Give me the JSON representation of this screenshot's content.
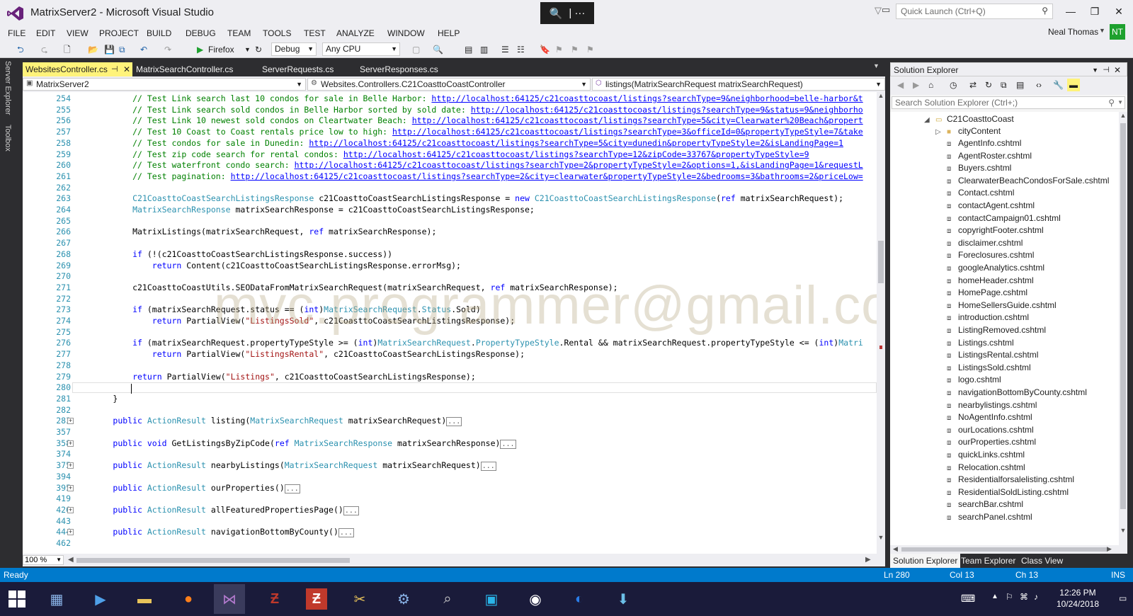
{
  "window": {
    "title": "MatrixServer2 - Microsoft Visual Studio",
    "quick_launch_placeholder": "Quick Launch (Ctrl+Q)",
    "user": "Neal Thomas",
    "avatar_initials": "NT",
    "zoom_tool_label": "| ···"
  },
  "menu": [
    "FILE",
    "EDIT",
    "VIEW",
    "PROJECT",
    "BUILD",
    "DEBUG",
    "TEAM",
    "TOOLS",
    "TEST",
    "ANALYZE",
    "WINDOW",
    "HELP"
  ],
  "toolbar": {
    "run_target": "Firefox",
    "configuration": "Debug",
    "platform": "Any CPU"
  },
  "left_rail": [
    "Server Explorer",
    "Toolbox"
  ],
  "doc_tabs": [
    {
      "label": "WebsitesController.cs",
      "active": true
    },
    {
      "label": "MatrixSearchController.cs",
      "active": false
    },
    {
      "label": "ServerRequests.cs",
      "active": false
    },
    {
      "label": "ServerResponses.cs",
      "active": false
    }
  ],
  "nav": {
    "project": "MatrixServer2",
    "class": "Websites.Controllers.C21CoasttoCoastController",
    "member": "listings(MatrixSearchRequest matrixSearchRequest)"
  },
  "code_lines": [
    {
      "n": "254",
      "segs": [
        [
          "cm",
          "            // Test Link search last 10 condos for sale in Belle Harbor: "
        ],
        [
          "lk",
          "http://localhost:64125/c21coasttocoast/listings?searchType=9&neighborhood=belle-harbor&t"
        ]
      ]
    },
    {
      "n": "255",
      "segs": [
        [
          "cm",
          "            // Test Link search sold condos in Belle Harbor sorted by sold date: "
        ],
        [
          "lk",
          "http://localhost:64125/c21coasttocoast/listings?searchType=9&status=9&neighborho"
        ]
      ]
    },
    {
      "n": "256",
      "segs": [
        [
          "cm",
          "            // Test Link 10 newest sold condos on Cleartwater Beach: "
        ],
        [
          "lk",
          "http://localhost:64125/c21coasttocoast/listings?searchType=5&city=Clearwater%20Beach&propert"
        ]
      ]
    },
    {
      "n": "257",
      "segs": [
        [
          "cm",
          "            // Test 10 Coast to Coast rentals price low to high: "
        ],
        [
          "lk",
          "http://localhost:64125/c21coasttocoast/listings?searchType=3&officeId=0&propertyTypeStyle=7&take"
        ]
      ]
    },
    {
      "n": "258",
      "segs": [
        [
          "cm",
          "            // Test condos for sale in Dunedin: "
        ],
        [
          "lk",
          "http://localhost:64125/c21coasttocoast/listings?searchType=5&city=dunedin&propertyTypeStyle=2&isLandingPage=1"
        ]
      ]
    },
    {
      "n": "259",
      "segs": [
        [
          "cm",
          "            // Test zip code search for rental condos: "
        ],
        [
          "lk",
          "http://localhost:64125/c21coasttocoast/listings?searchType=12&zipCode=33767&propertyTypeStyle=9"
        ]
      ]
    },
    {
      "n": "260",
      "segs": [
        [
          "cm",
          "            // Test waterfront condo search: "
        ],
        [
          "lk",
          "http://localhost:64125/c21coasttocoast/listings?searchType=2&propertyTypeStyle=2&options=1,&isLandingPage=1&requestL"
        ]
      ]
    },
    {
      "n": "261",
      "segs": [
        [
          "cm",
          "            // Test pagination: "
        ],
        [
          "lk",
          "http://localhost:64125/c21coasttocoast/listings?searchType=2&city=clearwater&propertyTypeStyle=2&bedrooms=3&bathrooms=2&priceLow="
        ]
      ]
    },
    {
      "n": "262",
      "segs": []
    },
    {
      "n": "263",
      "segs": [
        [
          "",
          "            "
        ],
        [
          "ty",
          "C21CoasttoCoastSearchListingsResponse"
        ],
        [
          "",
          " c21CoasttoCoastSearchListingsResponse = "
        ],
        [
          "kw",
          "new"
        ],
        [
          "",
          " "
        ],
        [
          "ty",
          "C21CoasttoCoastSearchListingsResponse"
        ],
        [
          "",
          "("
        ],
        [
          "kw",
          "ref"
        ],
        [
          "",
          " matrixSearchRequest);"
        ]
      ]
    },
    {
      "n": "264",
      "segs": [
        [
          "",
          "            "
        ],
        [
          "ty",
          "MatrixSearchResponse"
        ],
        [
          "",
          " matrixSearchResponse = c21CoasttoCoastSearchListingsResponse;"
        ]
      ]
    },
    {
      "n": "265",
      "segs": []
    },
    {
      "n": "266",
      "segs": [
        [
          "",
          "            MatrixListings(matrixSearchRequest, "
        ],
        [
          "kw",
          "ref"
        ],
        [
          "",
          " matrixSearchResponse);"
        ]
      ]
    },
    {
      "n": "267",
      "segs": []
    },
    {
      "n": "268",
      "segs": [
        [
          "",
          "            "
        ],
        [
          "kw",
          "if"
        ],
        [
          "",
          " (!(c21CoasttoCoastSearchListingsResponse.success))"
        ]
      ]
    },
    {
      "n": "269",
      "segs": [
        [
          "",
          "                "
        ],
        [
          "kw",
          "return"
        ],
        [
          "",
          " Content(c21CoasttoCoastSearchListingsResponse.errorMsg);"
        ]
      ]
    },
    {
      "n": "270",
      "segs": []
    },
    {
      "n": "271",
      "segs": [
        [
          "",
          "            c21CoasttoCoastUtils.SEODataFromMatrixSearchRequest(matrixSearchRequest, "
        ],
        [
          "kw",
          "ref"
        ],
        [
          "",
          " matrixSearchResponse);"
        ]
      ]
    },
    {
      "n": "272",
      "segs": []
    },
    {
      "n": "273",
      "segs": [
        [
          "",
          "            "
        ],
        [
          "kw",
          "if"
        ],
        [
          "",
          " (matrixSearchRequest.status == ("
        ],
        [
          "kw",
          "int"
        ],
        [
          "",
          ")"
        ],
        [
          "ty",
          "MatrixSearchRequest"
        ],
        [
          "",
          "."
        ],
        [
          "ty",
          "Status"
        ],
        [
          "",
          ".Sold)"
        ]
      ]
    },
    {
      "n": "274",
      "segs": [
        [
          "",
          "                "
        ],
        [
          "kw",
          "return"
        ],
        [
          "",
          " PartialView("
        ],
        [
          "st",
          "\"ListingsSold\""
        ],
        [
          "",
          ", c21CoasttoCoastSearchListingsResponse);"
        ]
      ]
    },
    {
      "n": "275",
      "segs": []
    },
    {
      "n": "276",
      "segs": [
        [
          "",
          "            "
        ],
        [
          "kw",
          "if"
        ],
        [
          "",
          " (matrixSearchRequest.propertyTypeStyle >= ("
        ],
        [
          "kw",
          "int"
        ],
        [
          "",
          ")"
        ],
        [
          "ty",
          "MatrixSearchRequest"
        ],
        [
          "",
          "."
        ],
        [
          "ty",
          "PropertyTypeStyle"
        ],
        [
          "",
          ".Rental && matrixSearchRequest.propertyTypeStyle <= ("
        ],
        [
          "kw",
          "int"
        ],
        [
          "",
          ")"
        ],
        [
          "ty",
          "Matri"
        ]
      ]
    },
    {
      "n": "277",
      "segs": [
        [
          "",
          "                "
        ],
        [
          "kw",
          "return"
        ],
        [
          "",
          " PartialView("
        ],
        [
          "st",
          "\"ListingsRental\""
        ],
        [
          "",
          ", c21CoasttoCoastSearchListingsResponse);"
        ]
      ]
    },
    {
      "n": "278",
      "segs": []
    },
    {
      "n": "279",
      "segs": [
        [
          "",
          "            "
        ],
        [
          "kw",
          "return"
        ],
        [
          "",
          " PartialView("
        ],
        [
          "st",
          "\"Listings\""
        ],
        [
          "",
          ", c21CoasttoCoastSearchListingsResponse);"
        ]
      ]
    },
    {
      "n": "280",
      "segs": [
        [
          "",
          "            "
        ]
      ]
    },
    {
      "n": "281",
      "segs": [
        [
          "",
          "        }"
        ]
      ]
    },
    {
      "n": "282",
      "segs": []
    },
    {
      "n": "283",
      "fold": true,
      "segs": [
        [
          "",
          "        "
        ],
        [
          "kw",
          "public"
        ],
        [
          "",
          " "
        ],
        [
          "ty",
          "ActionResult"
        ],
        [
          "",
          " listing("
        ],
        [
          "ty",
          "MatrixSearchRequest"
        ],
        [
          "",
          " matrixSearchRequest)"
        ],
        [
          "collapsed",
          "..."
        ]
      ]
    },
    {
      "n": "357",
      "segs": []
    },
    {
      "n": "358",
      "fold": true,
      "segs": [
        [
          "",
          "        "
        ],
        [
          "kw",
          "public"
        ],
        [
          "",
          " "
        ],
        [
          "kw",
          "void"
        ],
        [
          "",
          " GetListingsByZipCode("
        ],
        [
          "kw",
          "ref"
        ],
        [
          "",
          " "
        ],
        [
          "ty",
          "MatrixSearchResponse"
        ],
        [
          "",
          " matrixSearchResponse)"
        ],
        [
          "collapsed",
          "..."
        ]
      ]
    },
    {
      "n": "374",
      "segs": []
    },
    {
      "n": "375",
      "fold": true,
      "segs": [
        [
          "",
          "        "
        ],
        [
          "kw",
          "public"
        ],
        [
          "",
          " "
        ],
        [
          "ty",
          "ActionResult"
        ],
        [
          "",
          " nearbyListings("
        ],
        [
          "ty",
          "MatrixSearchRequest"
        ],
        [
          "",
          " matrixSearchRequest)"
        ],
        [
          "collapsed",
          "..."
        ]
      ]
    },
    {
      "n": "394",
      "segs": []
    },
    {
      "n": "395",
      "fold": true,
      "segs": [
        [
          "",
          "        "
        ],
        [
          "kw",
          "public"
        ],
        [
          "",
          " "
        ],
        [
          "ty",
          "ActionResult"
        ],
        [
          "",
          " ourProperties()"
        ],
        [
          "collapsed",
          "..."
        ]
      ]
    },
    {
      "n": "419",
      "segs": []
    },
    {
      "n": "420",
      "fold": true,
      "segs": [
        [
          "",
          "        "
        ],
        [
          "kw",
          "public"
        ],
        [
          "",
          " "
        ],
        [
          "ty",
          "ActionResult"
        ],
        [
          "",
          " allFeaturedPropertiesPage()"
        ],
        [
          "collapsed",
          "..."
        ]
      ]
    },
    {
      "n": "443",
      "segs": []
    },
    {
      "n": "444",
      "fold": true,
      "segs": [
        [
          "",
          "        "
        ],
        [
          "kw",
          "public"
        ],
        [
          "",
          " "
        ],
        [
          "ty",
          "ActionResult"
        ],
        [
          "",
          " navigationBottomByCounty()"
        ],
        [
          "collapsed",
          "..."
        ]
      ]
    },
    {
      "n": "462",
      "segs": []
    }
  ],
  "watermark": "mvc.programmer@gmail.com",
  "zoom_level": "100 %",
  "solution_explorer": {
    "title": "Solution Explorer",
    "search_placeholder": "Search Solution Explorer (Ctrl+;)",
    "root": "C21CoasttoCoast",
    "folder": "cityContent",
    "files": [
      "AgentInfo.cshtml",
      "AgentRoster.cshtml",
      "Buyers.cshtml",
      "ClearwaterBeachCondosForSale.cshtml",
      "Contact.cshtml",
      "contactAgent.cshtml",
      "contactCampaign01.cshtml",
      "copyrightFooter.cshtml",
      "disclaimer.cshtml",
      "Foreclosures.cshtml",
      "googleAnalytics.cshtml",
      "homeHeader.cshtml",
      "HomePage.cshtml",
      "HomeSellersGuide.cshtml",
      "introduction.cshtml",
      "ListingRemoved.cshtml",
      "Listings.cshtml",
      "ListingsRental.cshtml",
      "ListingsSold.cshtml",
      "logo.cshtml",
      "navigationBottomByCounty.cshtml",
      "nearbylistings.cshtml",
      "NoAgentInfo.cshtml",
      "ourLocations.cshtml",
      "ourProperties.cshtml",
      "quickLinks.cshtml",
      "Relocation.cshtml",
      "Residentialforsalelisting.cshtml",
      "ResidentialSoldListing.cshtml",
      "searchBar.cshtml",
      "searchPanel.cshtml"
    ],
    "bottom_tabs": [
      "Solution Explorer",
      "Team Explorer",
      "Class View"
    ]
  },
  "status": {
    "text": "Ready",
    "line": "Ln 280",
    "col": "Col 13",
    "ch": "Ch 13",
    "mode": "INS"
  },
  "clock": {
    "time": "12:26 PM",
    "date": "10/24/2018"
  }
}
